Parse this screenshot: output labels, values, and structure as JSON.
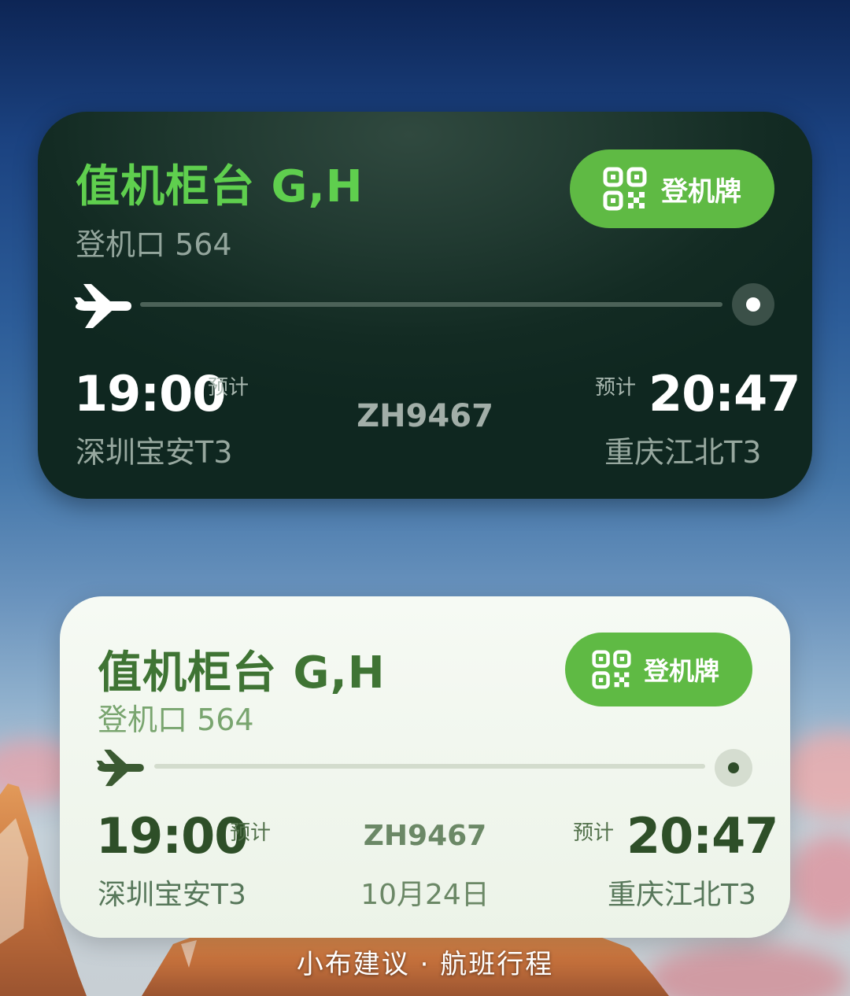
{
  "colors": {
    "accent_green": "#5fba44",
    "dark_card_title": "#5fcf4e",
    "light_card_title": "#3f7434",
    "dark_card_bg": "#132b23",
    "light_card_bg": "#eef4ea"
  },
  "widgets": [
    {
      "theme": "dark",
      "title": "值机柜台 G,H",
      "gate": "登机口 564",
      "boarding_pass_label": "登机牌",
      "departure": {
        "time": "19:00",
        "label": "预计",
        "airport": "深圳宝安T3"
      },
      "arrival": {
        "time": "20:47",
        "label": "预计",
        "airport": "重庆江北T3"
      },
      "flight_number": "ZH9467"
    },
    {
      "theme": "light",
      "title": "值机柜台 G,H",
      "gate": "登机口 564",
      "boarding_pass_label": "登机牌",
      "departure": {
        "time": "19:00",
        "label": "预计",
        "airport": "深圳宝安T3"
      },
      "arrival": {
        "time": "20:47",
        "label": "预计",
        "airport": "重庆江北T3"
      },
      "flight_number": "ZH9467",
      "date": "10月24日"
    }
  ],
  "caption": "小布建议 · 航班行程",
  "icons": {
    "boarding_pass": "qr-code-icon",
    "flight_progress": "airplane-icon",
    "destination": "destination-dot-icon"
  }
}
